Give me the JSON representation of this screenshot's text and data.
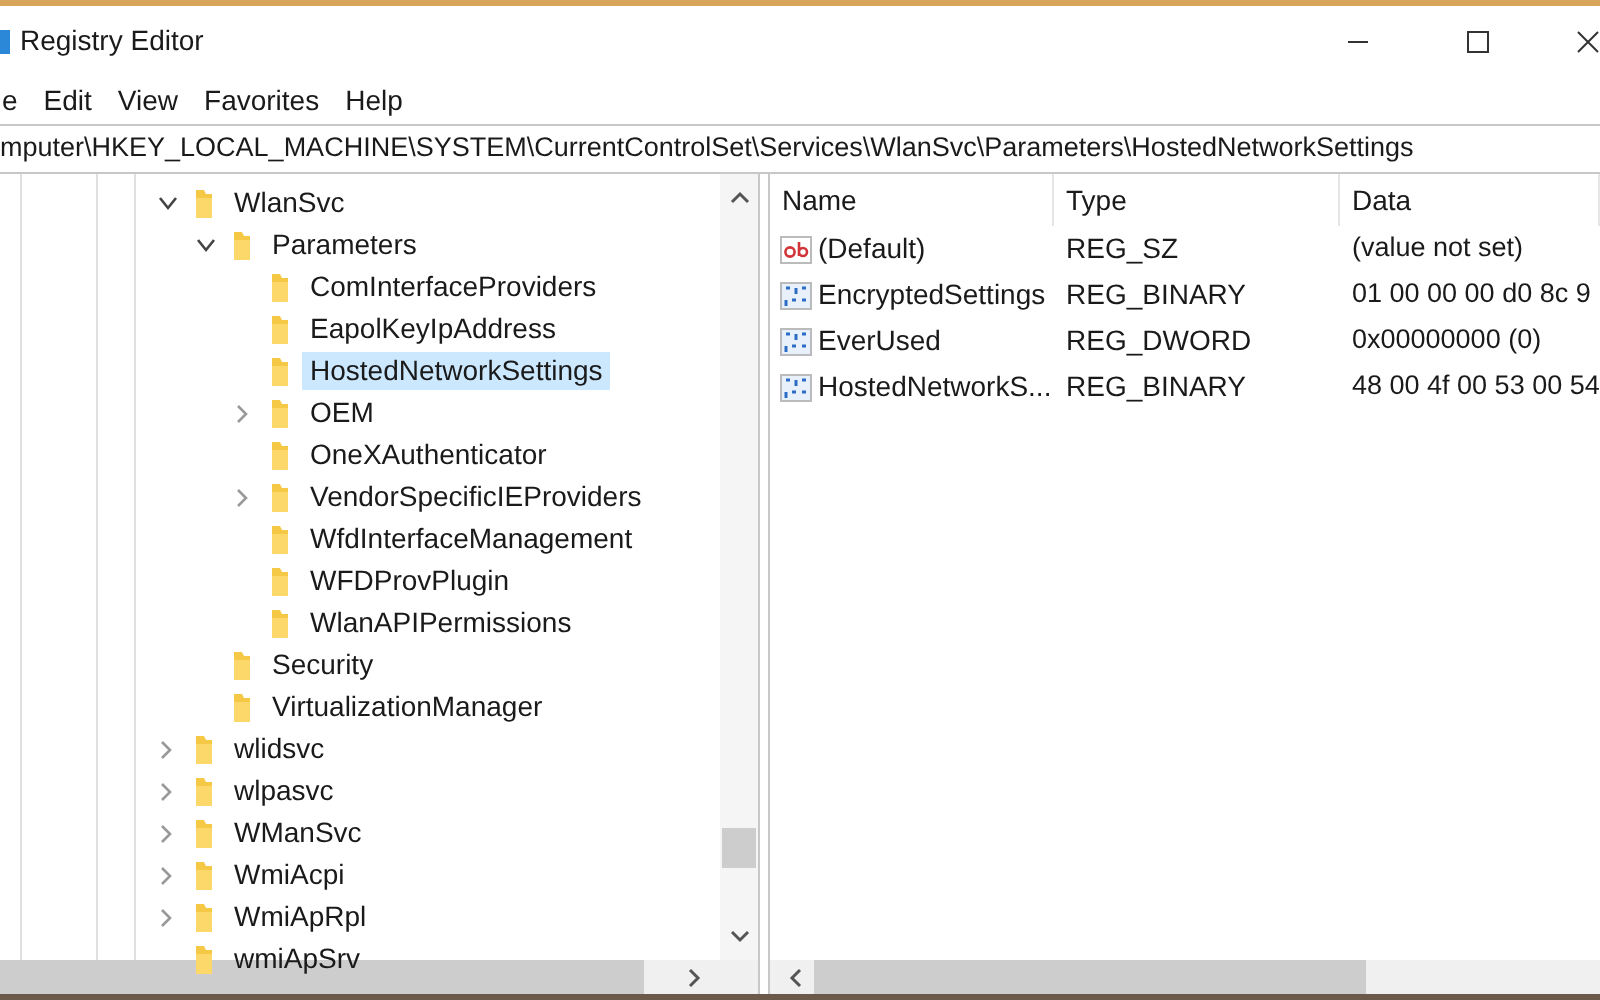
{
  "window": {
    "title": "Registry Editor"
  },
  "menu": [
    "e",
    "Edit",
    "View",
    "Favorites",
    "Help"
  ],
  "address": "mputer\\HKEY_LOCAL_MACHINE\\SYSTEM\\CurrentControlSet\\Services\\WlanSvc\\Parameters\\HostedNetworkSettings",
  "tree": [
    {
      "label": "WlanSvc",
      "expanded": true,
      "selected": false,
      "children": [
        {
          "label": "Parameters",
          "expanded": true,
          "selected": false,
          "children": [
            {
              "label": "ComInterfaceProviders",
              "selected": false
            },
            {
              "label": "EapolKeyIpAddress",
              "selected": false
            },
            {
              "label": "HostedNetworkSettings",
              "selected": true
            },
            {
              "label": "OEM",
              "expanded": false,
              "selected": false
            },
            {
              "label": "OneXAuthenticator",
              "selected": false
            },
            {
              "label": "VendorSpecificIEProviders",
              "expanded": false,
              "selected": false
            },
            {
              "label": "WfdInterfaceManagement",
              "selected": false
            },
            {
              "label": "WFDProvPlugin",
              "selected": false
            },
            {
              "label": "WlanAPIPermissions",
              "selected": false
            }
          ]
        },
        {
          "label": "Security",
          "selected": false
        },
        {
          "label": "VirtualizationManager",
          "selected": false
        }
      ]
    },
    {
      "label": "wlidsvc",
      "expanded": false,
      "selected": false
    },
    {
      "label": "wlpasvc",
      "expanded": false,
      "selected": false
    },
    {
      "label": "WManSvc",
      "expanded": false,
      "selected": false
    },
    {
      "label": "WmiAcpi",
      "expanded": false,
      "selected": false
    },
    {
      "label": "WmiApRpl",
      "expanded": false,
      "selected": false
    },
    {
      "label": "wmiApSrv",
      "selected": false
    }
  ],
  "table": {
    "columns": [
      "Name",
      "Type",
      "Data"
    ],
    "rows": [
      {
        "kind": "string",
        "name": "(Default)",
        "type": "REG_SZ",
        "data": "(value not set)"
      },
      {
        "kind": "binary",
        "name": "EncryptedSettings",
        "type": "REG_BINARY",
        "data": "01 00 00 00 d0 8c 9"
      },
      {
        "kind": "binary",
        "name": "EverUsed",
        "type": "REG_DWORD",
        "data": "0x00000000 (0)"
      },
      {
        "kind": "binary",
        "name": "HostedNetworkS...",
        "type": "REG_BINARY",
        "data": "48 00 4f 00 53 00 54"
      }
    ]
  }
}
